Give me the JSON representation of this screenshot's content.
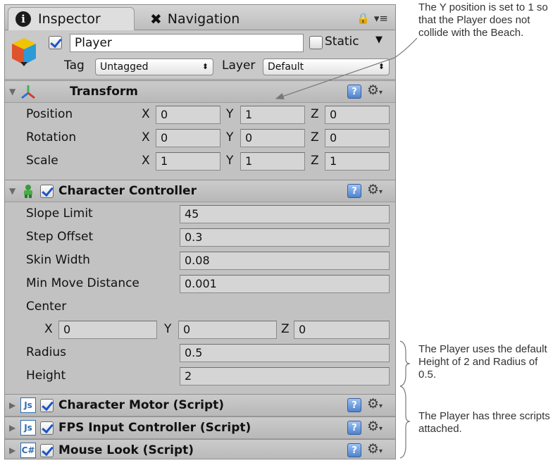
{
  "tabs": {
    "inspector": "Inspector",
    "navigation": "Navigation"
  },
  "object": {
    "name": "Player",
    "static_label": "Static",
    "tag_label": "Tag",
    "tag_value": "Untagged",
    "layer_label": "Layer",
    "layer_value": "Default"
  },
  "transform": {
    "title": "Transform",
    "rows": [
      {
        "label": "Position",
        "x": "0",
        "y": "1",
        "z": "0"
      },
      {
        "label": "Rotation",
        "x": "0",
        "y": "0",
        "z": "0"
      },
      {
        "label": "Scale",
        "x": "1",
        "y": "1",
        "z": "1"
      }
    ],
    "axes": [
      "X",
      "Y",
      "Z"
    ]
  },
  "character_controller": {
    "title": "Character Controller",
    "slope_limit_label": "Slope Limit",
    "slope_limit": "45",
    "step_offset_label": "Step Offset",
    "step_offset": "0.3",
    "skin_width_label": "Skin Width",
    "skin_width": "0.08",
    "min_move_label": "Min Move Distance",
    "min_move": "0.001",
    "center_label": "Center",
    "center_x": "0",
    "center_y": "0",
    "center_z": "0",
    "radius_label": "Radius",
    "radius": "0.5",
    "height_label": "Height",
    "height": "2"
  },
  "scripts": [
    {
      "title": "Character Motor (Script)",
      "icon": "js-script-icon"
    },
    {
      "title": "FPS Input Controller (Script)",
      "icon": "js-script-icon"
    },
    {
      "title": "Mouse Look (Script)",
      "icon": "csharp-script-icon"
    }
  ],
  "callouts": {
    "position": "The Y position is set to 1 so that the Player does not collide with the Beach.",
    "radius": "The Player uses the default Height of 2 and Radius of 0.5.",
    "scripts": "The Player has three scripts attached."
  }
}
